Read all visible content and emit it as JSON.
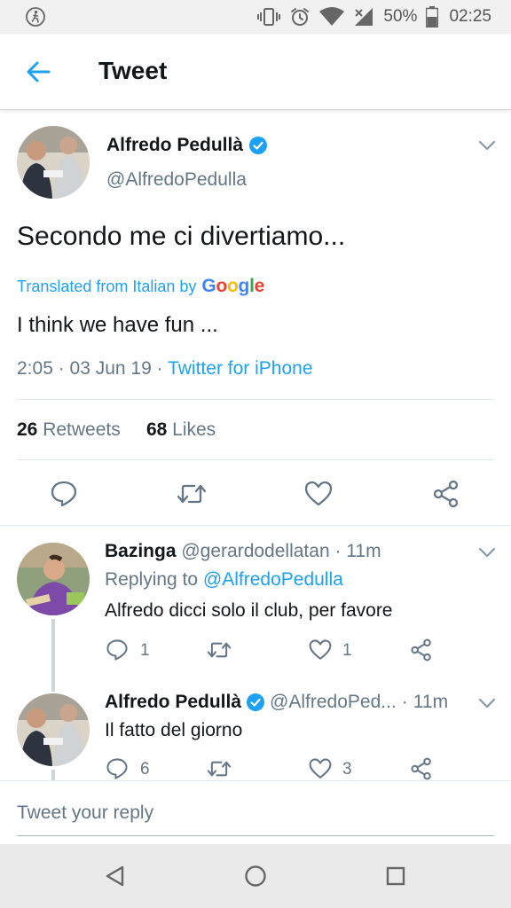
{
  "status_bar": {
    "battery_percent": "50%",
    "time": "02:25",
    "icons": [
      "accessibility-icon",
      "vibrate-icon",
      "alarm-icon",
      "wifi-icon",
      "signal-icon",
      "battery-icon"
    ]
  },
  "app_bar": {
    "title": "Tweet",
    "back_icon": "arrow-left-icon"
  },
  "main_tweet": {
    "author_name": "Alfredo Pedullà",
    "author_handle": "@AlfredoPedulla",
    "text": "Secondo me ci divertiamo...",
    "translated_label": "Translated from Italian by",
    "google_letters": [
      "G",
      "o",
      "o",
      "g",
      "l",
      "e"
    ],
    "translation": "I think we have fun ...",
    "time": "2:05",
    "date": "03 Jun 19",
    "source": "Twitter for iPhone",
    "retweets_count": "26",
    "retweets_label": "Retweets",
    "likes_count": "68",
    "likes_label": "Likes"
  },
  "replies": [
    {
      "name": "Bazinga",
      "handle": "@gerardodellatan",
      "time": "11m",
      "replying_label": "Replying to",
      "replying_handle": "@AlfredoPedulla",
      "text": "Alfredo dicci solo il club, per favore",
      "reply_count": "1",
      "like_count": "1"
    },
    {
      "name": "Alfredo Pedullà",
      "handle": "@AlfredoPed...",
      "time": "11m",
      "text": "Il fatto del giorno",
      "reply_count": "6",
      "like_count": "3"
    }
  ],
  "reply_box": {
    "placeholder": "Tweet your reply"
  },
  "colors": {
    "twitter_blue": "#1da1f2",
    "secondary_text": "#657786",
    "google": [
      "#4285f4",
      "#ea4335",
      "#fbbc05",
      "#4285f4",
      "#34a853",
      "#ea4335"
    ]
  }
}
